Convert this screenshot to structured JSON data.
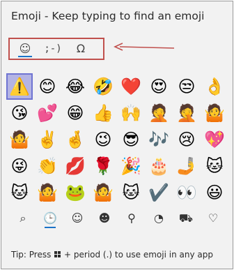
{
  "window": {
    "title": "Emoji - Keep typing to find an emoji"
  },
  "tabs": [
    {
      "id": "emoji",
      "glyph": "☺",
      "icon": "smiley-icon"
    },
    {
      "id": "kaomoji",
      "glyph": ";-)",
      "icon": "kaomoji-icon"
    },
    {
      "id": "symbols",
      "glyph": "Ω",
      "icon": "omega-icon"
    }
  ],
  "annotation": {
    "color": "#c0504d"
  },
  "emoji_rows": [
    [
      "⚠️",
      "😊",
      "😂",
      "🤣",
      "❤️",
      "😍",
      "😒",
      "👌"
    ],
    [
      "😘",
      "💕",
      "😁",
      "👍",
      "🙌",
      "🤦",
      "🤦",
      "🤷"
    ],
    [
      "🤷",
      "✌️",
      "🤞",
      "😉",
      "😎",
      "🎶",
      "😢",
      "💖"
    ],
    [
      "😜",
      "👏",
      "💋",
      "🌹",
      "🎉",
      "🎂",
      "🤳",
      "🐱"
    ],
    [
      "🐱",
      "🤷",
      "🐸",
      "🤷",
      "🐱",
      "✔️",
      "👀",
      "😃"
    ]
  ],
  "categories": [
    {
      "glyph": "⌕",
      "icon": "search-icon"
    },
    {
      "glyph": "🕒",
      "icon": "recent-clock-icon",
      "active": true
    },
    {
      "glyph": "☺",
      "icon": "smiley-category-icon"
    },
    {
      "glyph": "☻",
      "icon": "people-icon"
    },
    {
      "glyph": "⚲",
      "icon": "celebration-icon"
    },
    {
      "glyph": "◔",
      "icon": "food-icon"
    },
    {
      "glyph": "⛟",
      "icon": "travel-icon"
    },
    {
      "glyph": "♡",
      "icon": "heart-icon"
    }
  ],
  "tip": {
    "prefix": "Tip: Press",
    "suffix": "+ period (.) to use emoji in any app"
  }
}
